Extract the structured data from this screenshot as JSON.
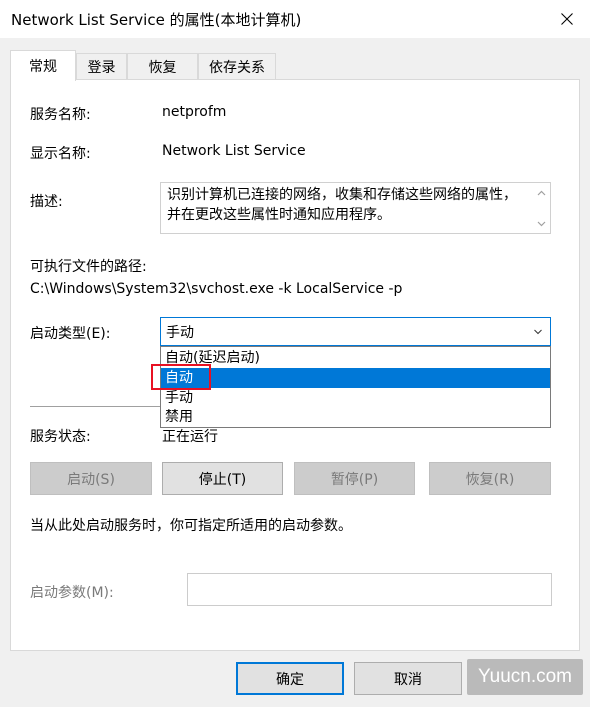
{
  "window": {
    "title": "Network List Service 的属性(本地计算机)"
  },
  "tabs": [
    {
      "label": "常规"
    },
    {
      "label": "登录"
    },
    {
      "label": "恢复"
    },
    {
      "label": "依存关系"
    }
  ],
  "general": {
    "service_name_label": "服务名称:",
    "service_name_value": "netprofm",
    "display_name_label": "显示名称:",
    "display_name_value": "Network List Service",
    "description_label": "描述:",
    "description_value": "识别计算机已连接的网络，收集和存储这些网络的属性，并在更改这些属性时通知应用程序。",
    "exe_path_label": "可执行文件的路径:",
    "exe_path_value": "C:\\Windows\\System32\\svchost.exe -k LocalService -p",
    "startup_type_label": "启动类型(E):",
    "startup_type_value": "手动",
    "startup_options": [
      "自动(延迟启动)",
      "自动",
      "手动",
      "禁用"
    ],
    "service_status_label": "服务状态:",
    "service_status_value": "正在运行",
    "start_button": "启动(S)",
    "stop_button": "停止(T)",
    "pause_button": "暂停(P)",
    "resume_button": "恢复(R)",
    "hint_text": "当从此处启动服务时，你可指定所适用的启动参数。",
    "start_params_label": "启动参数(M):",
    "start_params_value": ""
  },
  "footer": {
    "ok_button": "确定",
    "cancel_button": "取消"
  },
  "watermark": "Yuucn.com",
  "colors": {
    "accent": "#0078d7",
    "highlight_box": "#e81123",
    "disabled_text": "#7a7a7a"
  }
}
